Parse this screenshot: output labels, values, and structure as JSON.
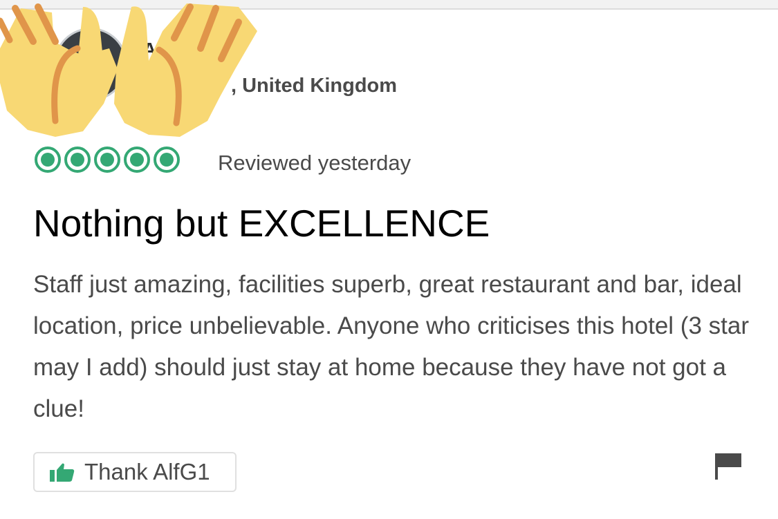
{
  "reviewer": {
    "name_fragment": "A",
    "location": ", United Kingdom"
  },
  "review": {
    "rating": 5,
    "date": "Reviewed yesterday",
    "title": "Nothing but EXCELLENCE",
    "body": "Staff just amazing, facilities superb, great restaurant and bar, ideal location, price unbelievable. Anyone who criticises this hotel (3 star may I add) should just stay at home because they have not got a clue!"
  },
  "actions": {
    "thank_label": "Thank AlfG1",
    "thank_icon": "thumbs-up-icon",
    "report_icon": "flag-icon"
  },
  "overlay": {
    "emoji": "raising-hands-emoji"
  },
  "colors": {
    "rating_green": "#34a874",
    "emoji_yellow": "#f8d874",
    "emoji_orange": "#e0954a"
  }
}
